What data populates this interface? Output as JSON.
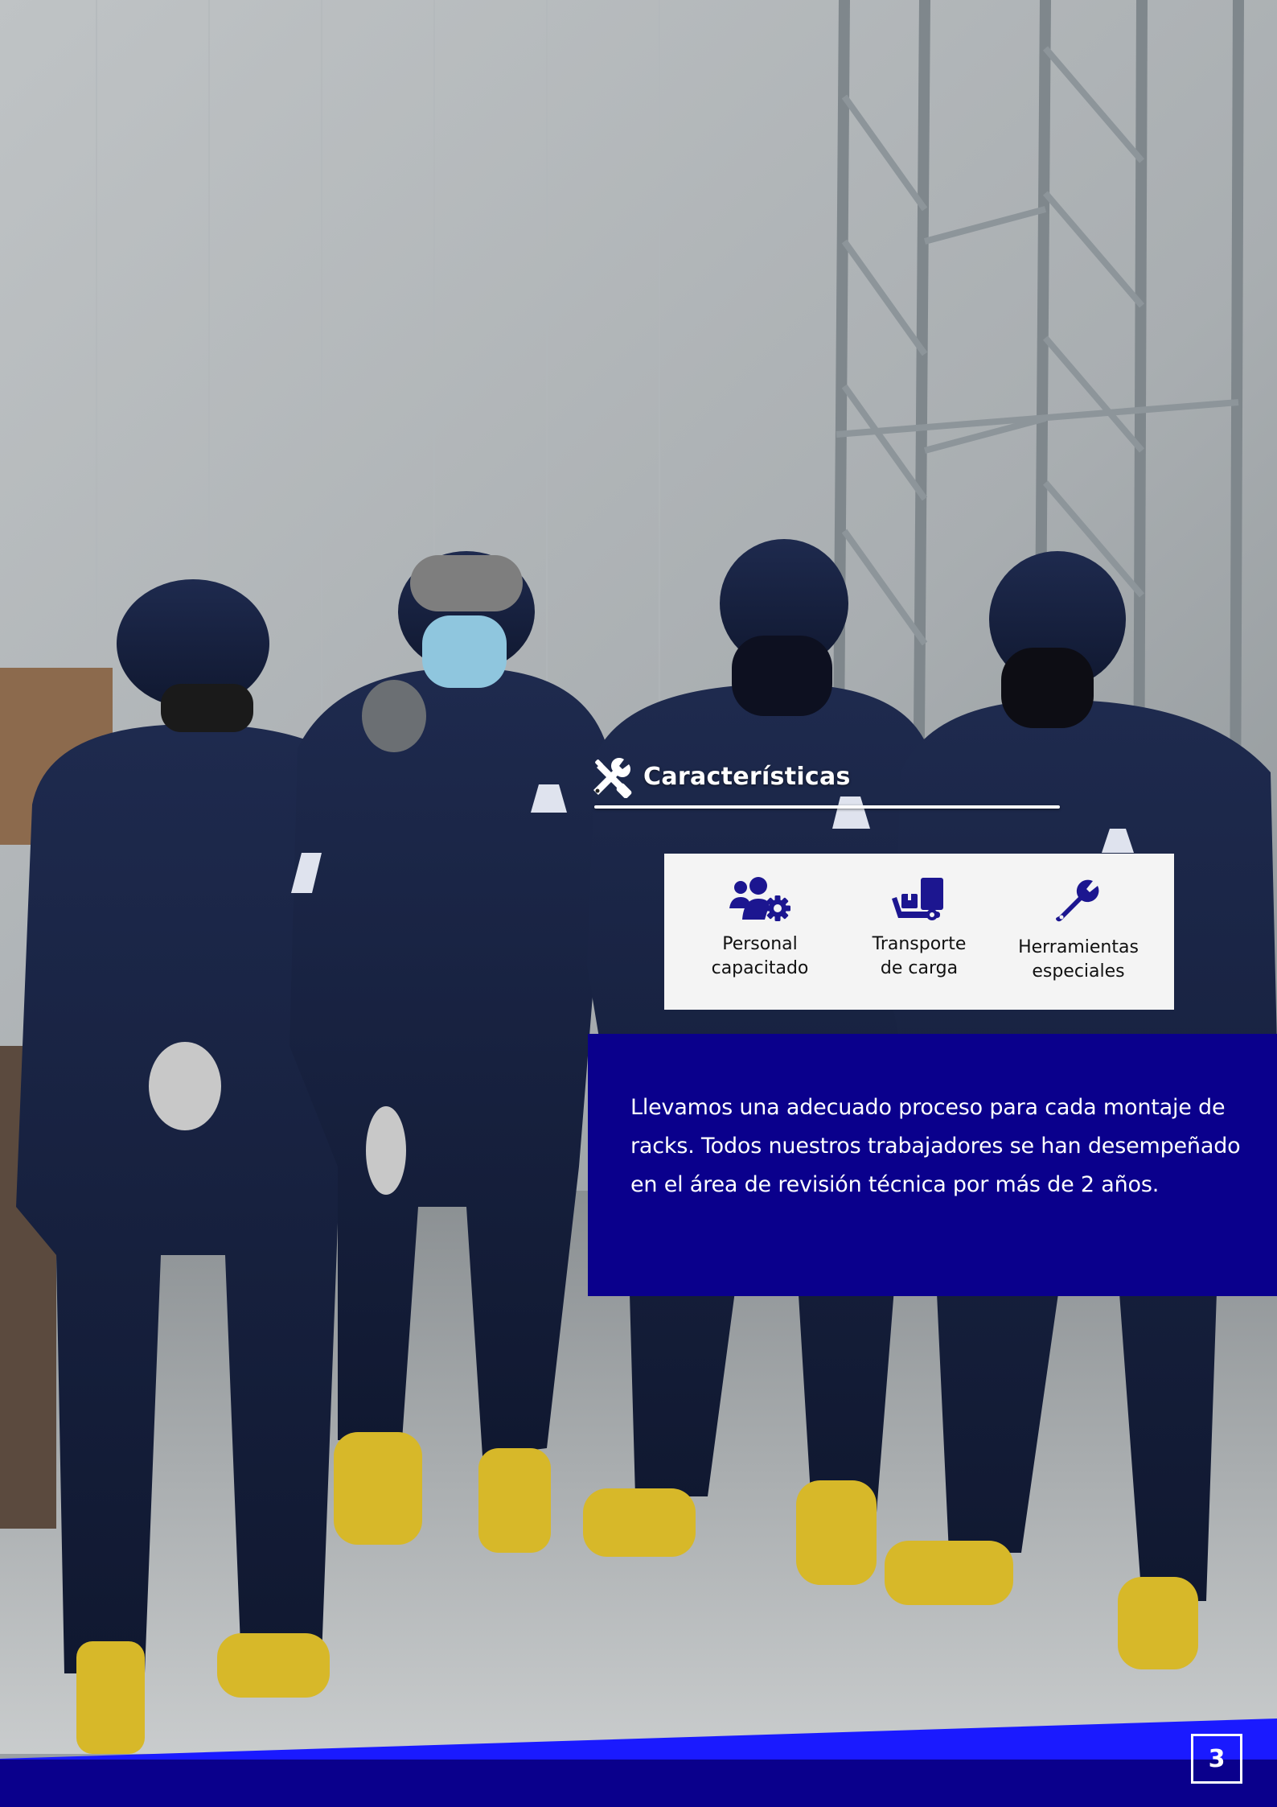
{
  "heading": {
    "title": "Características"
  },
  "features": [
    {
      "icon": "users-gear-icon",
      "line1": "Personal",
      "line2": "capacitado"
    },
    {
      "icon": "dolly-truck-icon",
      "line1": "Transporte",
      "line2": "de carga"
    },
    {
      "icon": "wrench-icon",
      "line1": "Herramientas",
      "line2": "especiales"
    }
  ],
  "description": "Llevamos una adecuado proceso para cada montaje de racks. Todos nuestros trabajadores se han desempeñado en el área de revisión técnica por más de 2 años.",
  "page": {
    "number": "3"
  },
  "colors": {
    "brand_navy": "#0a008c",
    "accent_blue": "#1a1aff",
    "icon_navy": "#1c1690",
    "card_bg": "#f4f4f4"
  }
}
